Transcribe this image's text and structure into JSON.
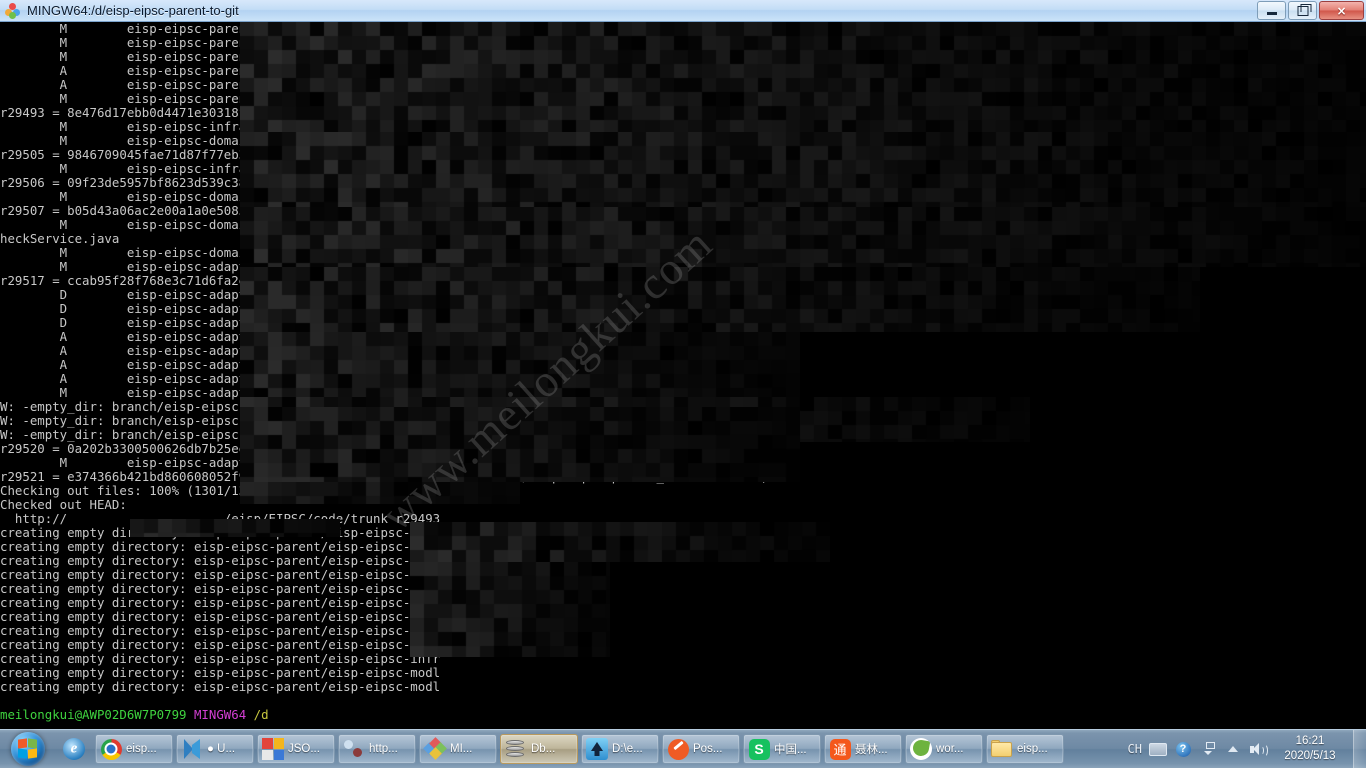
{
  "window": {
    "title": "MINGW64:/d/eisp-eipsc-parent-to-git",
    "icon": "mingw-logo-icon",
    "buttons": {
      "minimize": "minimize-button",
      "maximize": "maximize-button",
      "close": "×"
    }
  },
  "terminal": {
    "watermark": "www.meilongkui.com",
    "prompt": {
      "user_host": "meilongkui@AWP02D6W7P0799",
      "shell": "MINGW64",
      "path": "/d"
    },
    "lines": [
      "\tM\teisp-eipsc-parent/",
      "\tM\teisp-eipsc-parent/",
      "\tM\teisp-eipsc-parent/",
      "\tA\teisp-eipsc-parent/",
      "\tA\teisp-eipsc-parent/",
      "\tM\teisp-eipsc-parent/",
      "r29493 = 8e476d17ebb0d4471e30318f9",
      "\tM\teisp-eipsc-infrast",
      "\tM\teisp-eipsc-domain/",
      "r29505 = 9846709045fae71d87f77eb39",
      "\tM\teisp-eipsc-infrast",
      "r29506 = 09f23de5957bf8623d539c381",
      "\tM\teisp-eipsc-domain/",
      "r29507 = b05d43a06ac2e00a1a0e5085e",
      "\tM\teisp-eipsc-domain/",
      "heckService.java",
      "\tM\teisp-eipsc-domain/",
      "\tM\teisp-eipsc-adaptor",
      "r29517 = ccab95f28f768e3c71d6fa2e2",
      "\tD\teisp-eipsc-adaptor",
      "\tD\teisp-eipsc-adaptor",
      "\tD\teisp-eipsc-adaptor",
      "\tA\teisp-eipsc-adaptor",
      "\tA\teisp-eipsc-adaptor",
      "\tA\teisp-eipsc-adaptor",
      "\tA\teisp-eipsc-adaptor",
      "\tM\teisp-eipsc-adaptor",
      "W: -empty_dir: branch/eisp-eipsc-p",
      "W: -empty_dir: branch/eisp-eipsc-p",
      "W: -empty_dir: branch/eisp-eipsc-p",
      "r29520 = 0a202b3300500626db7b25ee6",
      "\tM\teisp-eipsc-adaptor",
      "r29521 = e374366b421bd860608052f9913d81cea5383811 (refs/remotes/origin/eisp-eipsc-parent_xiane20200317)",
      "Checking out files: 100% (1301/1301), done.",
      "Checked out HEAD:",
      "  http://                     /eisp/EIPSC/code/trunk r29493",
      "creating empty directory: eisp-eipsc-parent/eisp-eipsc-adap",
      "creating empty directory: eisp-eipsc-parent/eisp-eipsc-adap",
      "creating empty directory: eisp-eipsc-parent/eisp-eipsc-api/",
      "creating empty directory: eisp-eipsc-parent/eisp-eipsc-api/",
      "creating empty directory: eisp-eipsc-parent/eisp-eipsc-app/",
      "creating empty directory: eisp-eipsc-parent/eisp-eipsc-app/",
      "creating empty directory: eisp-eipsc-parent/eisp-eipsc-comm",
      "creating empty directory: eisp-eipsc-parent/eisp-eipsc-doma",
      "creating empty directory: eisp-eipsc-parent/eisp-eipsc-infr",
      "creating empty directory: eisp-eipsc-parent/eisp-eipsc-infr",
      "creating empty directory: eisp-eipsc-parent/eisp-eipsc-modl",
      "creating empty directory: eisp-eipsc-parent/eisp-eipsc-modl"
    ]
  },
  "taskbar": {
    "start_button": "start-orb",
    "quicklaunch": [
      {
        "name": "internet-explorer",
        "icon": "ie-icon"
      }
    ],
    "tasks": [
      {
        "name": "chrome",
        "icon": "chrome-icon",
        "label": "eisp...",
        "active": false
      },
      {
        "name": "vscode",
        "icon": "vscode-icon",
        "label": "● U...",
        "active": false
      },
      {
        "name": "json-editor",
        "icon": "json-icon",
        "label": "JSO...",
        "active": false
      },
      {
        "name": "http-tool",
        "icon": "http-icon",
        "label": "http...",
        "active": false
      },
      {
        "name": "mi-app",
        "icon": "mi-icon",
        "label": "MI...",
        "active": false
      },
      {
        "name": "db-tool",
        "icon": "database-icon",
        "label": "Db...",
        "active": true
      },
      {
        "name": "filezilla",
        "icon": "ftp-icon",
        "label": "D:\\e...",
        "active": false
      },
      {
        "name": "postman",
        "icon": "postman-icon",
        "label": "Pos...",
        "active": false
      },
      {
        "name": "sogou",
        "icon": "sogou-icon",
        "label": "中国...",
        "active": false
      },
      {
        "name": "tong-app",
        "icon": "tong-icon",
        "label": "聂林...",
        "active": false
      },
      {
        "name": "spring-tool",
        "icon": "spring-icon",
        "label": "wor...",
        "active": false
      },
      {
        "name": "explorer",
        "icon": "folder-icon",
        "label": "eisp...",
        "active": false
      }
    ],
    "tray": {
      "language": "CH",
      "icons": [
        "keyboard-icon",
        "help-icon",
        "ime-icon",
        "show-hidden-icons-icon",
        "volume-icon"
      ]
    },
    "clock": {
      "time": "16:21",
      "date": "2020/5/13"
    }
  }
}
